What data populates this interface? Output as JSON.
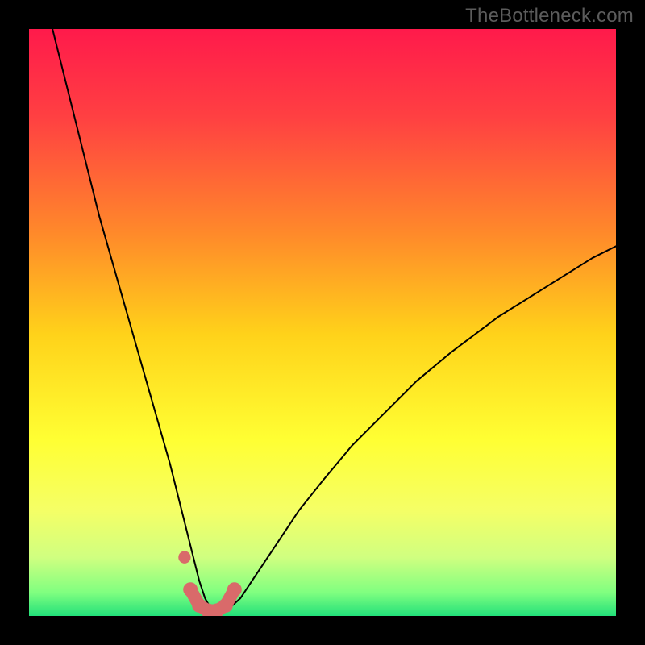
{
  "watermark": "TheBottleneck.com",
  "chart_data": {
    "type": "line",
    "title": "",
    "xlabel": "",
    "ylabel": "",
    "xlim": [
      0,
      100
    ],
    "ylim": [
      0,
      100
    ],
    "background_gradient": {
      "stops": [
        {
          "offset": 0.0,
          "color": "#ff1a4b"
        },
        {
          "offset": 0.15,
          "color": "#ff4042"
        },
        {
          "offset": 0.35,
          "color": "#ff8a2a"
        },
        {
          "offset": 0.52,
          "color": "#ffd21a"
        },
        {
          "offset": 0.7,
          "color": "#ffff33"
        },
        {
          "offset": 0.82,
          "color": "#f5ff66"
        },
        {
          "offset": 0.9,
          "color": "#d0ff80"
        },
        {
          "offset": 0.96,
          "color": "#80ff80"
        },
        {
          "offset": 1.0,
          "color": "#22e07a"
        }
      ]
    },
    "series": [
      {
        "name": "bottleneck-curve",
        "color": "#000000",
        "width": 2,
        "x": [
          4,
          6,
          8,
          10,
          12,
          14,
          16,
          18,
          20,
          22,
          24,
          26,
          27,
          28,
          29,
          30,
          31,
          32,
          33,
          34,
          36,
          38,
          42,
          46,
          50,
          55,
          60,
          66,
          72,
          80,
          88,
          96,
          100
        ],
        "y": [
          100,
          92,
          84,
          76,
          68,
          61,
          54,
          47,
          40,
          33,
          26,
          18,
          14,
          10,
          6,
          3,
          1.2,
          0.6,
          0.6,
          1.2,
          3,
          6,
          12,
          18,
          23,
          29,
          34,
          40,
          45,
          51,
          56,
          61,
          63
        ]
      }
    ],
    "highlight": {
      "name": "bottom-highlight",
      "color": "#d96a6a",
      "dot_radius": 9,
      "stroke_width": 16,
      "x": [
        27.5,
        29,
        30.5,
        32,
        33.5,
        35
      ],
      "y": [
        4.5,
        1.8,
        0.9,
        0.9,
        1.8,
        4.5
      ],
      "extra_dot": {
        "x": 26.5,
        "y": 10
      }
    }
  }
}
